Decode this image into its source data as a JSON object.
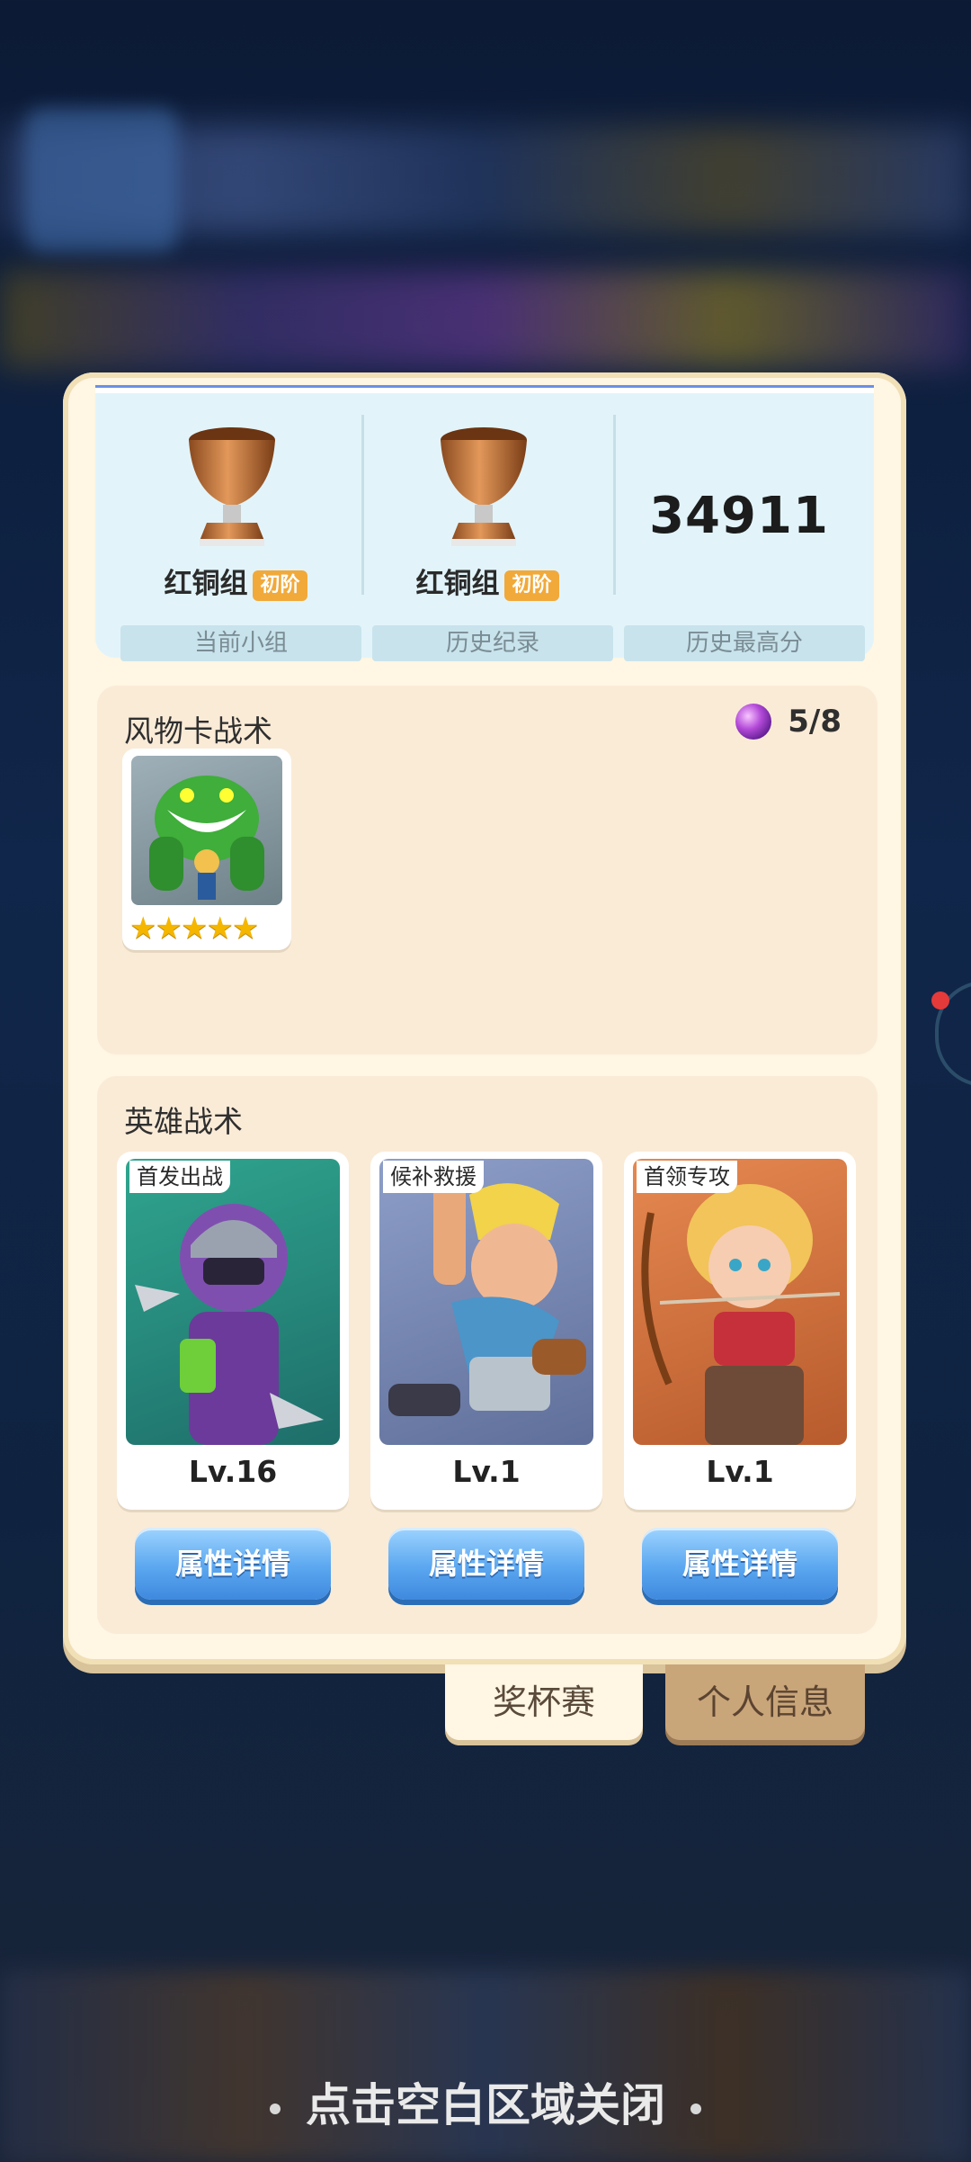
{
  "stats": {
    "current_group": {
      "rank": "红铜组",
      "tier": "初阶",
      "label": "当前小组"
    },
    "history_record": {
      "rank": "红铜组",
      "tier": "初阶",
      "label": "历史纪录"
    },
    "best_score": {
      "value": "34911",
      "label": "历史最高分"
    }
  },
  "card_tactics": {
    "title": "风物卡战术",
    "count": "5/8",
    "cards": [
      {
        "stars": "★★★★★"
      }
    ]
  },
  "hero_tactics": {
    "title": "英雄战术",
    "heroes": [
      {
        "tag": "首发出战",
        "level": "Lv.16",
        "button": "属性详情"
      },
      {
        "tag": "候补救援",
        "level": "Lv.1",
        "button": "属性详情"
      },
      {
        "tag": "首领专攻",
        "level": "Lv.1",
        "button": "属性详情"
      }
    ]
  },
  "tabs": {
    "trophy": "奖杯赛",
    "profile": "个人信息"
  },
  "close_hint": "点击空白区域关闭",
  "colors": {
    "panel": "#fff6e3",
    "button": "#5ba7f0",
    "tier_badge": "#f1a93a"
  }
}
